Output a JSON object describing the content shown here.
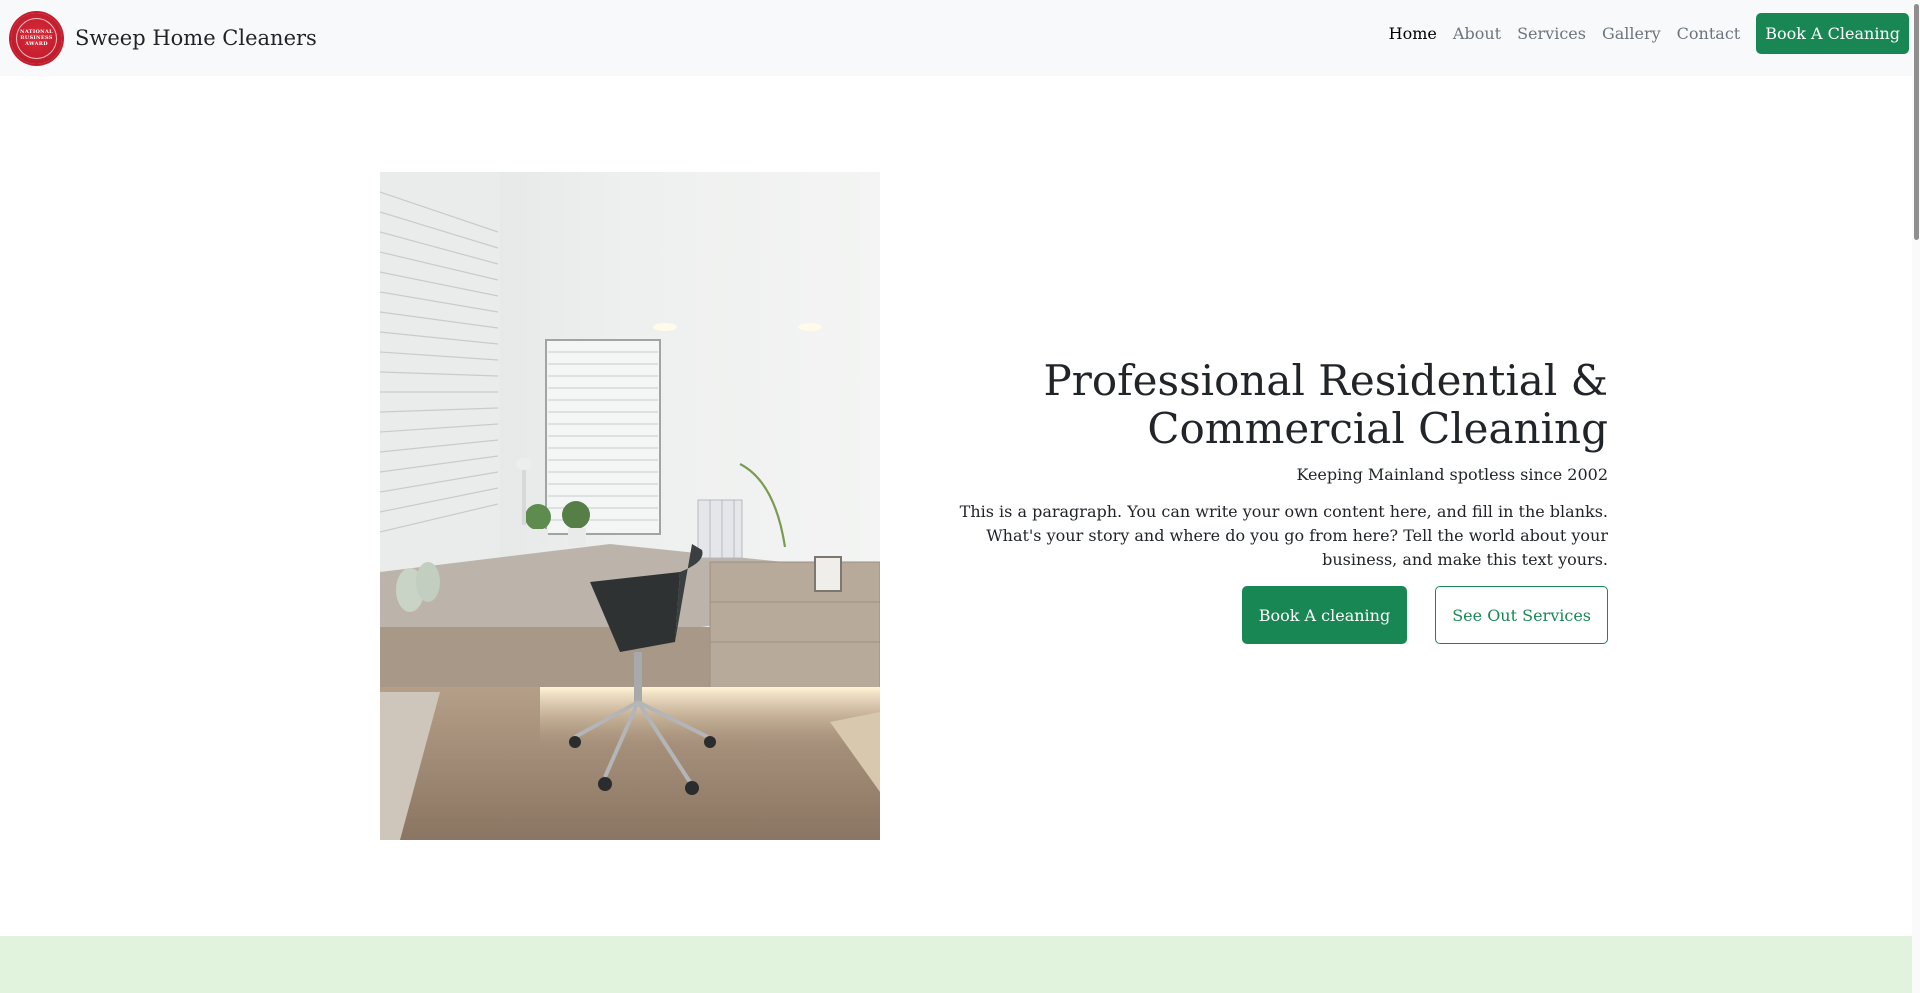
{
  "header": {
    "logo_text": "NATIONAL BUSINESS AWARD",
    "brand": "Sweep Home Cleaners",
    "nav": [
      {
        "label": "Home"
      },
      {
        "label": "About"
      },
      {
        "label": "Services"
      },
      {
        "label": "Gallery"
      },
      {
        "label": "Contact"
      }
    ],
    "cta": "Book A Cleaning"
  },
  "hero": {
    "title_line1": "Professional Residential &",
    "title_line2": "Commercial Cleaning",
    "subtitle": "Keeping Mainland spotless since 2002",
    "paragraph": "This is a paragraph. You can write your own content here, and fill in the blanks. What's your story and where do you go from here? Tell the world about your business, and make this text yours.",
    "primary_button": "Book A cleaning",
    "secondary_button": "See Out Services"
  },
  "colors": {
    "accent": "#198754",
    "navbar_bg": "#f8f9fa",
    "band": "#e1f2dd",
    "badge": "#c41e2e"
  }
}
